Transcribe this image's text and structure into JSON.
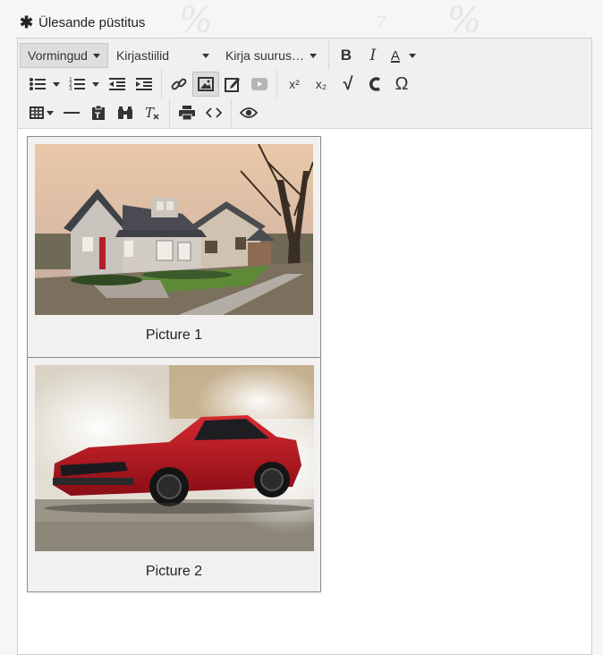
{
  "field": {
    "required_mark": "✱",
    "label": "Ülesande püstitus"
  },
  "toolbar": {
    "formats_label": "Vormingud",
    "font_family_label": "Kirjastiilid",
    "font_size_label": "Kirja suurus…",
    "bold": "B",
    "italic": "I",
    "text_color": "A",
    "superscript": "x²",
    "subscript": "x₂",
    "math": "√",
    "special_char": "Ω"
  },
  "figures": [
    {
      "caption": "Picture 1"
    },
    {
      "caption": "Picture 2"
    }
  ],
  "colors": {
    "toolbar_bg": "#f0f0f0",
    "figure_bg": "#f3f1ef",
    "car_red": "#b01420"
  }
}
